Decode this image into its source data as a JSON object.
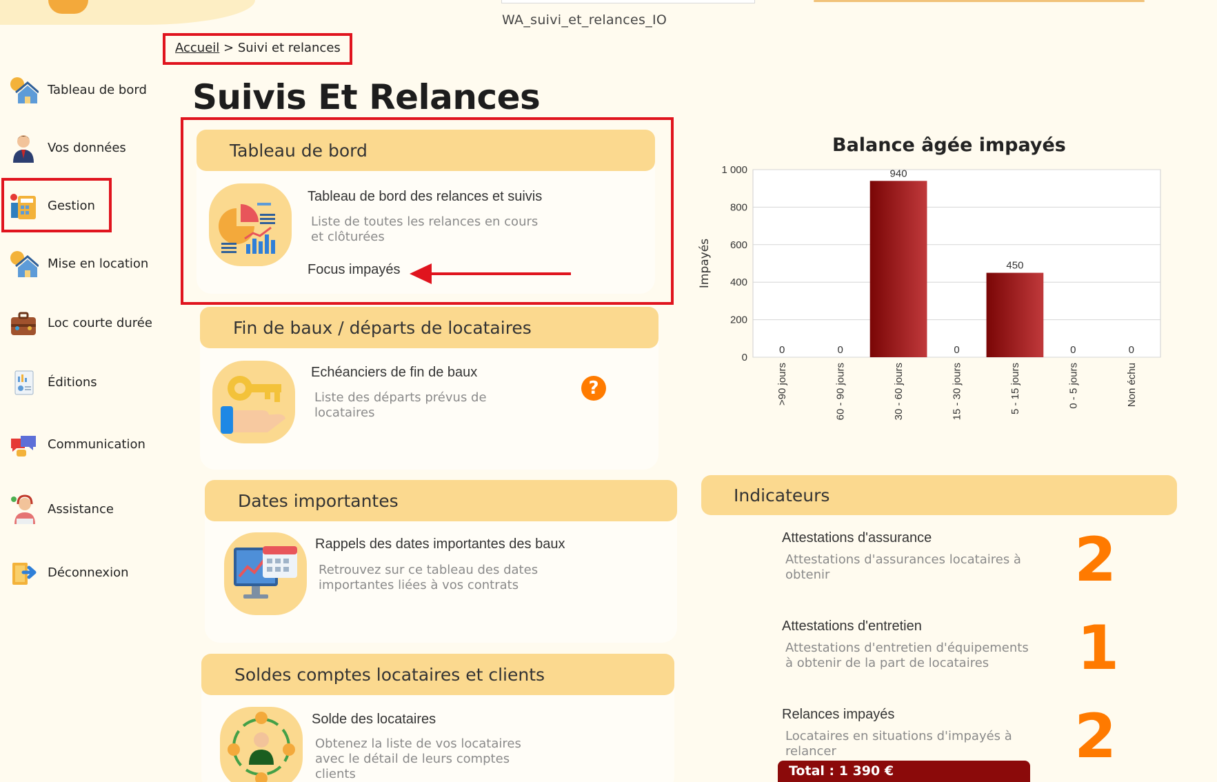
{
  "header": {
    "window_code": "WA_suivi_et_relances_IO"
  },
  "breadcrumb": {
    "home": "Accueil",
    "separator": ">",
    "current": "Suivi et relances"
  },
  "sidebar": {
    "items": [
      {
        "label": "Tableau de bord",
        "icon": "dashboard-house-icon"
      },
      {
        "label": "Vos données",
        "icon": "user-profile-icon"
      },
      {
        "label": "Gestion",
        "icon": "management-calculator-icon"
      },
      {
        "label": "Mise en location",
        "icon": "rental-house-icon"
      },
      {
        "label": "Loc courte durée",
        "icon": "suitcase-icon"
      },
      {
        "label": "Éditions",
        "icon": "document-chart-icon"
      },
      {
        "label": "Communication",
        "icon": "chat-bubbles-icon"
      },
      {
        "label": "Assistance",
        "icon": "support-agent-icon"
      },
      {
        "label": "Déconnexion",
        "icon": "logout-door-icon"
      }
    ]
  },
  "page": {
    "title": "Suivis Et Relances"
  },
  "cards": {
    "dashboard": {
      "header": "Tableau de bord",
      "item_title": "Tableau de bord des relances et suivis",
      "item_desc_1": "Liste de toutes les relances en cours",
      "item_desc_2": "et clôturées",
      "link": "Focus impayés",
      "icon": "pie-chart-icon"
    },
    "leases": {
      "header": "Fin de baux / départs de locataires",
      "item_title": "Echéanciers de fin de baux",
      "item_desc_1": "Liste des départs prévus de",
      "item_desc_2": "locataires",
      "help": "?",
      "icon": "key-hand-icon"
    },
    "dates": {
      "header": "Dates importantes",
      "item_title": "Rappels des dates importantes des baux",
      "item_desc_1": "Retrouvez sur ce tableau des dates",
      "item_desc_2": "importantes liées à vos contrats",
      "icon": "calendar-monitor-icon"
    },
    "balances": {
      "header": "Soldes comptes locataires et clients",
      "item_title": "Solde des locataires",
      "item_desc_1": "Obtenez la liste de vos locataires",
      "item_desc_2": "avec le détail de leurs comptes",
      "item_desc_3": "clients",
      "icon": "money-cycle-icon"
    }
  },
  "chart_data": {
    "type": "bar",
    "title": "Balance âgée impayés",
    "ylabel": "Impayés",
    "xlabel": "",
    "categories": [
      ">90 jours",
      "60 - 90 jours",
      "30 - 60 jours",
      "15 - 30 jours",
      "5 - 15 jours",
      "0 - 5 jours",
      "Non échu"
    ],
    "values": [
      0,
      0,
      940,
      0,
      450,
      0,
      0
    ],
    "ylim": [
      0,
      1000
    ],
    "yticks": [
      0,
      200,
      400,
      600,
      800,
      1000
    ],
    "ytick_labels": [
      "0",
      "200",
      "400",
      "600",
      "800",
      "1 000"
    ],
    "grid": true,
    "bar_color": "#9b1010"
  },
  "indicators": {
    "header": "Indicateurs",
    "items": [
      {
        "title": "Attestations d'assurance",
        "desc_1": "Attestations d'assurances locataires à",
        "desc_2": "obtenir",
        "value": "2"
      },
      {
        "title": "Attestations d'entretien",
        "desc_1": "Attestations d'entretien d'équipements",
        "desc_2": "à obtenir de la part de locataires",
        "value": "1"
      },
      {
        "title": "Relances impayés",
        "desc_1": "Locataires en situations d'impayés à",
        "desc_2": "relancer",
        "value": "2"
      }
    ],
    "total": "Total : 1 390 €"
  },
  "colors": {
    "accent": "#fbd98f",
    "highlight_red": "#e0141e",
    "indicator_orange": "#ff7a00",
    "total_bg": "#8b0a0a"
  }
}
